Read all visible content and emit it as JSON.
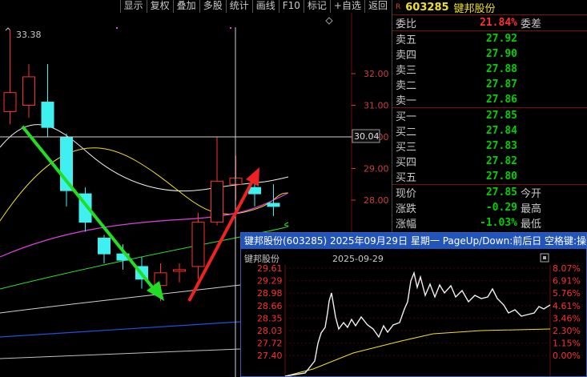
{
  "toolbar": {
    "buttons": [
      "显示",
      "复权",
      "叠加",
      "多股",
      "统计",
      "画线",
      "F10",
      "标记",
      "+自选",
      "返回"
    ]
  },
  "kline": {
    "high_marker": "33.38",
    "price_ticks": [
      "32.00",
      "31.00",
      "30.00",
      "29.00",
      "28.00"
    ],
    "crosshair_price": "30.04",
    "candles": [
      {
        "o": 30.8,
        "c": 31.4,
        "h": 33.4,
        "l": 30.4,
        "up": true
      },
      {
        "o": 31.0,
        "c": 31.9,
        "h": 32.3,
        "l": 30.6,
        "up": true
      },
      {
        "o": 31.1,
        "c": 30.3,
        "h": 32.3,
        "l": 30.0,
        "up": false
      },
      {
        "o": 30.0,
        "c": 28.3,
        "h": 30.1,
        "l": 27.8,
        "up": false
      },
      {
        "o": 28.2,
        "c": 27.3,
        "h": 28.4,
        "l": 27.0,
        "up": false
      },
      {
        "o": 26.8,
        "c": 26.3,
        "h": 26.9,
        "l": 26.0,
        "up": false
      },
      {
        "o": 26.3,
        "c": 26.1,
        "h": 26.6,
        "l": 25.8,
        "up": false
      },
      {
        "o": 25.9,
        "c": 25.5,
        "h": 26.2,
        "l": 25.2,
        "up": false
      },
      {
        "o": 25.3,
        "c": 25.7,
        "h": 26.0,
        "l": 24.8,
        "up": true
      },
      {
        "o": 25.8,
        "c": 25.8,
        "h": 26.0,
        "l": 25.4,
        "up": true
      },
      {
        "o": 25.9,
        "c": 27.3,
        "h": 27.6,
        "l": 25.5,
        "up": true
      },
      {
        "o": 27.3,
        "c": 28.6,
        "h": 30.0,
        "l": 27.2,
        "up": true
      },
      {
        "o": 28.5,
        "c": 28.7,
        "h": 29.4,
        "l": 28.0,
        "up": true
      },
      {
        "o": 28.4,
        "c": 28.2,
        "h": 28.7,
        "l": 27.8,
        "up": false
      },
      {
        "o": 27.9,
        "c": 27.8,
        "h": 28.5,
        "l": 27.5,
        "up": false
      }
    ]
  },
  "quote": {
    "r_badge": "R",
    "code": "603285",
    "name": "键邦股份",
    "weibi_label": "委比",
    "weibi_value": "21.84%",
    "weicha_label": "委差",
    "sells": [
      {
        "label": "卖五",
        "price": "27.92"
      },
      {
        "label": "卖四",
        "price": "27.90"
      },
      {
        "label": "卖三",
        "price": "27.88"
      },
      {
        "label": "卖二",
        "price": "27.87"
      },
      {
        "label": "卖一",
        "price": "27.86"
      }
    ],
    "buys": [
      {
        "label": "买一",
        "price": "27.85"
      },
      {
        "label": "买二",
        "price": "27.84"
      },
      {
        "label": "买三",
        "price": "27.83"
      },
      {
        "label": "买四",
        "price": "27.82"
      },
      {
        "label": "买五",
        "price": "27.80"
      }
    ],
    "stats": [
      {
        "label": "现价",
        "value": "27.85",
        "extra": "今开",
        "color": "green"
      },
      {
        "label": "涨跌",
        "value": "-0.29",
        "extra": "最高",
        "color": "green"
      },
      {
        "label": "涨幅",
        "value": "-1.03%",
        "extra": "最低",
        "color": "green"
      }
    ]
  },
  "popup": {
    "title": "键邦股份(603285) 2025年09月29日 星期一 PageUp/Down:前后日 空格键:操作",
    "sub_name": "键邦股份",
    "sub_date": "2025-09-29",
    "left_ticks": [
      "29.61",
      "29.29",
      "28.98",
      "28.66",
      "28.35",
      "28.03",
      "27.72",
      "27.40"
    ],
    "right_ticks": [
      "8.07%",
      "6.91%",
      "5.76%",
      "4.61%",
      "3.46%",
      "2.30%",
      "1.15%",
      "0.00%"
    ]
  }
}
